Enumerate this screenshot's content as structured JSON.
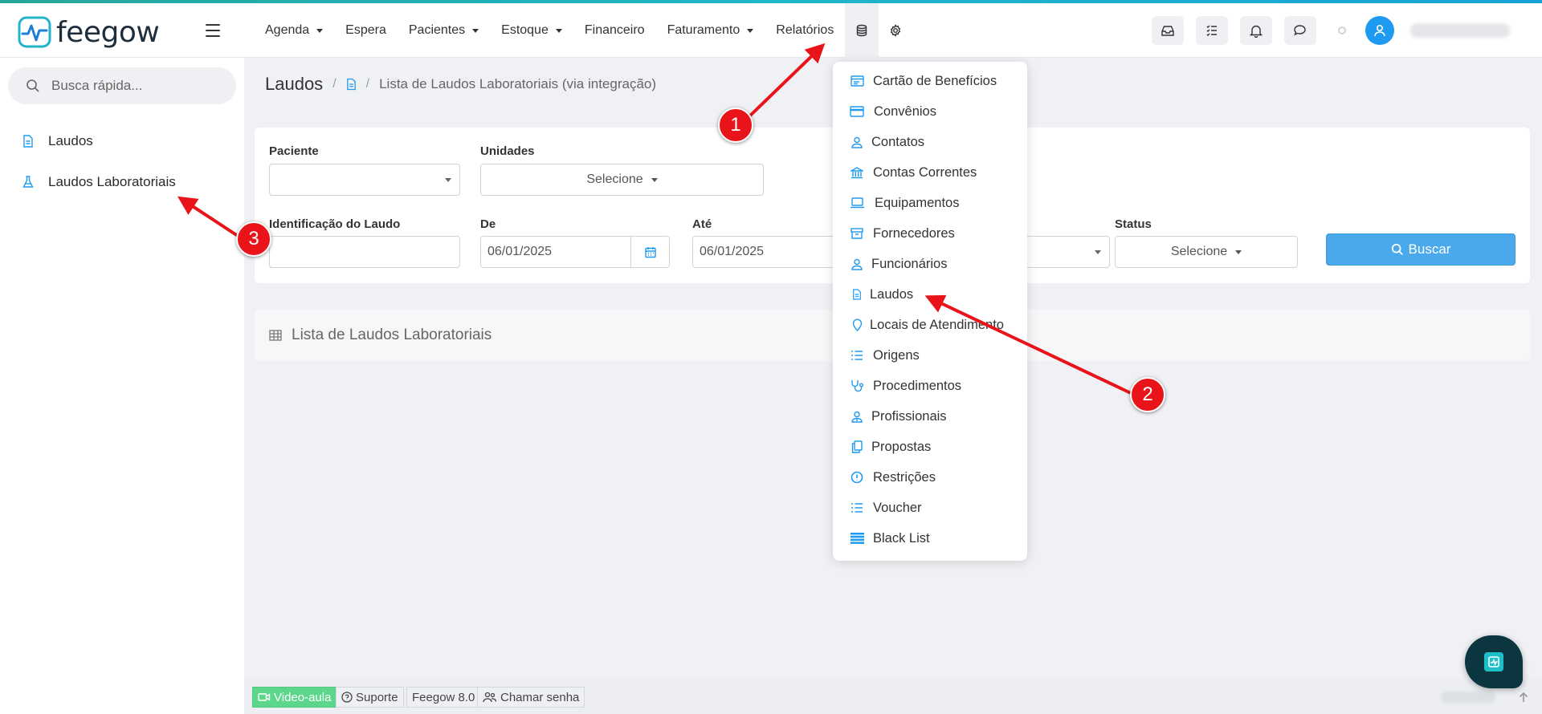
{
  "app": {
    "brand": "feegow",
    "accent_color": "#1e9bf0"
  },
  "nav": {
    "items": [
      {
        "label": "Agenda",
        "has_caret": true
      },
      {
        "label": "Espera",
        "has_caret": false
      },
      {
        "label": "Pacientes",
        "has_caret": true
      },
      {
        "label": "Estoque",
        "has_caret": true
      },
      {
        "label": "Financeiro",
        "has_caret": false
      },
      {
        "label": "Faturamento",
        "has_caret": true
      },
      {
        "label": "Relatórios",
        "has_caret": false
      }
    ],
    "icon_items": [
      "database-icon",
      "gear-icon"
    ]
  },
  "toolbar_right": {
    "icons": [
      "inbox-icon",
      "checklist-icon",
      "bell-icon",
      "chat-icon"
    ]
  },
  "sidebar": {
    "search_placeholder": "Busca rápida...",
    "items": [
      {
        "label": "Laudos",
        "icon": "document-icon"
      },
      {
        "label": "Laudos Laboratoriais",
        "icon": "flask-icon"
      }
    ]
  },
  "breadcrumb": {
    "title": "Laudos",
    "separator": "/",
    "page": "Lista de Laudos Laboratoriais (via integração)"
  },
  "filters": {
    "paciente_label": "Paciente",
    "paciente_value": "",
    "unidades_label": "Unidades",
    "unidades_value": "Selecione",
    "identificacao_label": "Identificação do Laudo",
    "identificacao_value": "",
    "de_label": "De",
    "de_value": "06/01/2025",
    "ate_label": "Até",
    "ate_value": "06/01/2025",
    "status_label": "Status",
    "status_value": "Selecione",
    "search_button": "Buscar"
  },
  "list_panel": {
    "title": "Lista de Laudos Laboratoriais"
  },
  "dropdown": {
    "items": [
      {
        "label": "Cartão de Benefícios",
        "icon": "card-list-icon"
      },
      {
        "label": "Convênios",
        "icon": "credit-card-icon"
      },
      {
        "label": "Contatos",
        "icon": "user-icon"
      },
      {
        "label": "Contas Correntes",
        "icon": "bank-icon"
      },
      {
        "label": "Equipamentos",
        "icon": "laptop-icon"
      },
      {
        "label": "Fornecedores",
        "icon": "archive-icon"
      },
      {
        "label": "Funcionários",
        "icon": "user-icon"
      },
      {
        "label": "Laudos",
        "icon": "document-icon"
      },
      {
        "label": "Locais de Atendimento",
        "icon": "map-pin-icon"
      },
      {
        "label": "Origens",
        "icon": "list-icon"
      },
      {
        "label": "Procedimentos",
        "icon": "stethoscope-icon"
      },
      {
        "label": "Profissionais",
        "icon": "user-doctor-icon"
      },
      {
        "label": "Propostas",
        "icon": "copy-icon"
      },
      {
        "label": "Restrições",
        "icon": "alert-circle-icon"
      },
      {
        "label": "Voucher",
        "icon": "list-icon"
      },
      {
        "label": "Black List",
        "icon": "rows-icon"
      }
    ]
  },
  "annotations": [
    {
      "number": "1"
    },
    {
      "number": "2"
    },
    {
      "number": "3"
    }
  ],
  "footer": {
    "video_aula": "Video-aula",
    "suporte": "Suporte",
    "version": "Feegow 8.0",
    "chamar_senha": "Chamar senha"
  }
}
